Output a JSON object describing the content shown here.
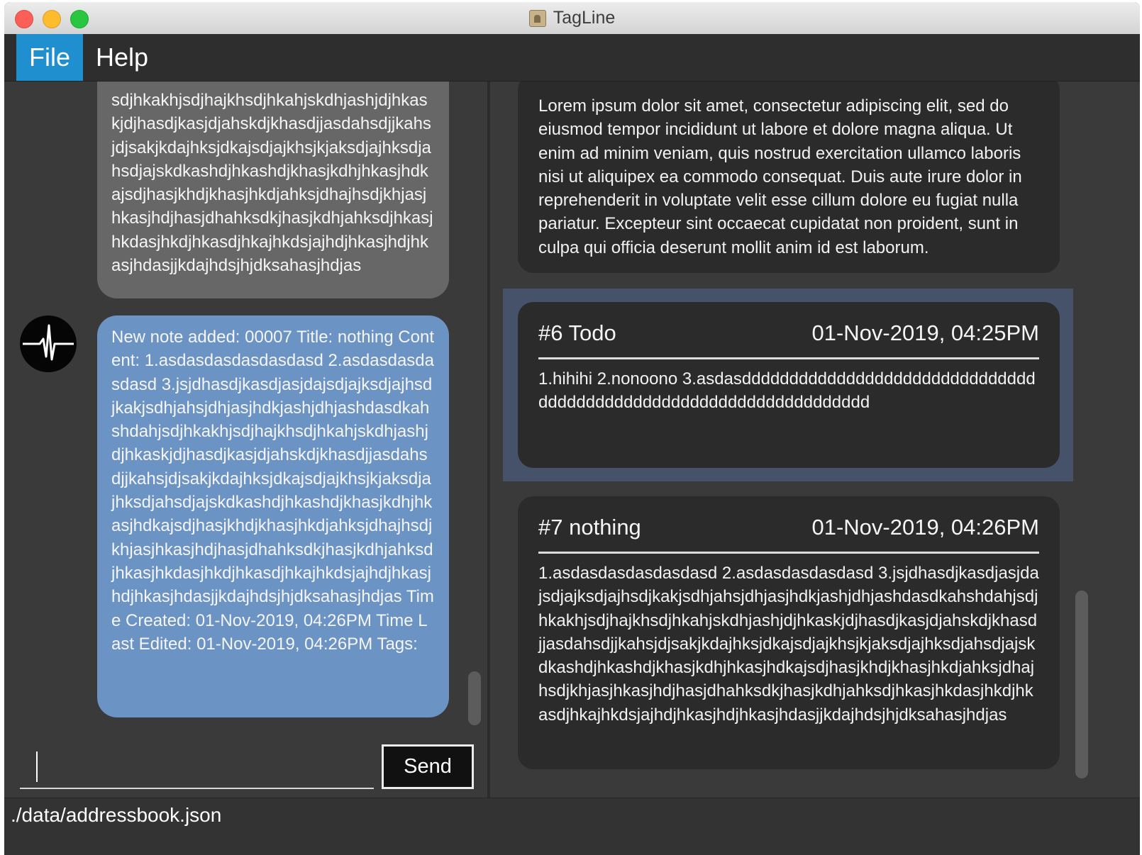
{
  "window": {
    "title": "TagLine"
  },
  "menu": {
    "file": "File",
    "help": "Help"
  },
  "chat": {
    "previous_message": "sdjhkakhjsdjhajkhsdjhkahjskdhjashjdjhkaskjdjhasdjkasjdjahskdjkhasdjjasdahsdjjkahsjdjsakjkdajhksjdkajsdjajkhsjkjaksdjajhksdjahsdjajskdkashdjhkashdjkhasjkdhjhkasjhdkajsdjhasjkhdjkhasjhkdjahksjdhajhsdjkhjasjhkasjhdjhasjdhahksdkjhasjkdhjahksdjhkasjhkdasjhkdjhkasdjhkajhkdsjajhdjhkasjhdjhkasjhdasjjkdajhdsjhjdksahasjhdjas",
    "latest_message": "New note added: 00007 Title: nothing Content: 1.asdasdasdasdasdasd 2.asdasdasdasdasd 3.jsjdhasdjkasdjasjdajsdjajksdjajhsdjkakjsdhjahsjdhjasjhdkjashjdhjashdasdkahshdahjsdjhkakhjsdjhajkhsdjhkahjskdhjashjdjhkaskjdjhasdjkasjdjahskdjkhasdjjasdahsdjjkahsjdjsakjkdajhksjdkajsdjajkhsjkjaksdjajhksdjahsdjajskdkashdjhkashdjkhasjkdhjhkasjhdkajsdjhasjkhdjkhasjhkdjahksjdhajhsdjkhjasjhkasjhdjhasjdhahksdkjhasjkdhjahksdjhkasjhkdasjhkdjhkasdjhkajhkdsjajhdjhkasjhdjhkasjhdasjjkdajhdsjhjdksahasjhdjas Time Created: 01-Nov-2019, 04:26PM Time Last Edited: 01-Nov-2019, 04:26PM Tags:",
    "input_value": "",
    "send_label": "Send"
  },
  "notes": {
    "previous_content": "Lorem ipsum dolor sit amet, consectetur adipiscing elit, sed do eiusmod tempor incididunt ut labore et dolore magna aliqua. Ut enim ad minim veniam, quis nostrud exercitation ullamco laboris nisi ut aliquipex ea commodo consequat. Duis aute irure dolor in reprehenderit in voluptate velit esse cillum dolore eu fugiat nulla pariatur. Excepteur sint occaecat cupidatat non proident, sunt in culpa qui officia deserunt mollit anim id est laborum.",
    "items": [
      {
        "title": "#6 Todo",
        "date": "01-Nov-2019, 04:25PM",
        "content": "1.hihihi 2.nonoono 3.asdasdddddddddddddddddddddddddddddddddddddddddddddddddddddddddddddddddd",
        "selected": true
      },
      {
        "title": "#7 nothing",
        "date": "01-Nov-2019, 04:26PM",
        "content": "1.asdasdasdasdasdasd 2.asdasdasdasdasd 3.jsjdhasdjkasdjasjdajsdjajksdjajhsdjkakjsdhjahsjdhjasjhdkjashjdhjashdasdkahshdahjsdjhkakhjsdjhajkhsdjhkahjskdhjashjdjhkaskjdjhasdjkasjdjahskdjkhasdjjasdahsdjjkahsjdjsakjkdajhksjdkajsdjajkhsjkjaksdjajhksdjahsdjajskdkashdjhkashdjkhasjkdhjhkasjhdkajsdjhasjkhdjkhasjhkdjahksjdhajhsdjkhjasjhkasjhdjhasjdhahksdkjhasjkdhjahksdjhkasjhkdasjhkdjhkasdjhkajhkdsjajhdjhkasjhdjhkasjhdasjjkdajhdsjhjdksahasjhdjas",
        "selected": false
      }
    ]
  },
  "status": {
    "file_path": "./data/addressbook.json"
  },
  "colors": {
    "menu_active": "#1f8fcf",
    "bubble_bot": "#6b93c4",
    "bubble_old": "#676767",
    "selected_note": "#45526a"
  }
}
